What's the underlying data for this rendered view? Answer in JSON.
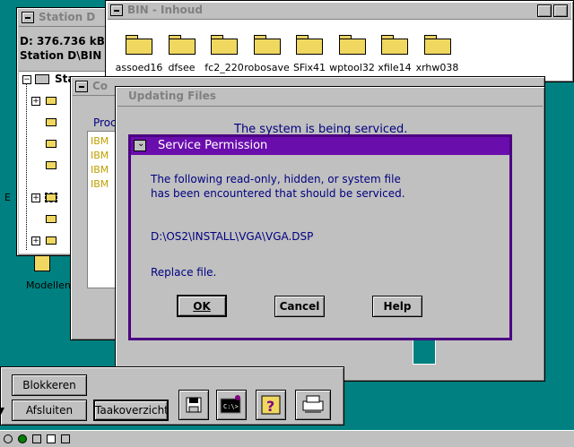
{
  "station_window": {
    "title": "Station D",
    "drive_line": "D:  376.736 kB",
    "path_line": "Station D\\BIN",
    "tree_root": "Sta"
  },
  "bin_window": {
    "title": "BIN - Inhoud",
    "folders": [
      "assoed16",
      "dfsee",
      "fc2_220",
      "robosave",
      "SFix41",
      "wptool32",
      "xfile14",
      "xrhw038"
    ]
  },
  "behind_window": {
    "title": "Co",
    "label": "Proc",
    "list_items": [
      "IBM",
      "IBM",
      "IBM",
      "IBM"
    ]
  },
  "updating_dialog": {
    "title": "Updating Files",
    "status_text": "The system is being serviced."
  },
  "service_dialog": {
    "title": "Service Permission",
    "message_line1": "The following read-only, hidden, or system file",
    "message_line2": "has been encountered that should be serviced.",
    "file_path": "D:\\OS2\\INSTALL\\VGA\\VGA.DSP",
    "action": "Replace file.",
    "ok_label": "OK",
    "cancel_label": "Cancel",
    "help_label": "Help"
  },
  "desktop": {
    "icon_label": "Modellen",
    "left_edge_letter": "E"
  },
  "launchpad": {
    "lock_label": "Blokkeren",
    "shutdown_label": "Afsluiten",
    "tasklist_label": "Taakoverzicht",
    "tool_icons": [
      "disk-icon",
      "command-prompt-icon",
      "help-icon",
      "printer-icon"
    ]
  },
  "colors": {
    "desktop": "#008080",
    "dialog_frame": "#4b0082",
    "dialog_title": "#6a0dad",
    "dialog_text": "#000080",
    "folder": "#f0d860"
  }
}
